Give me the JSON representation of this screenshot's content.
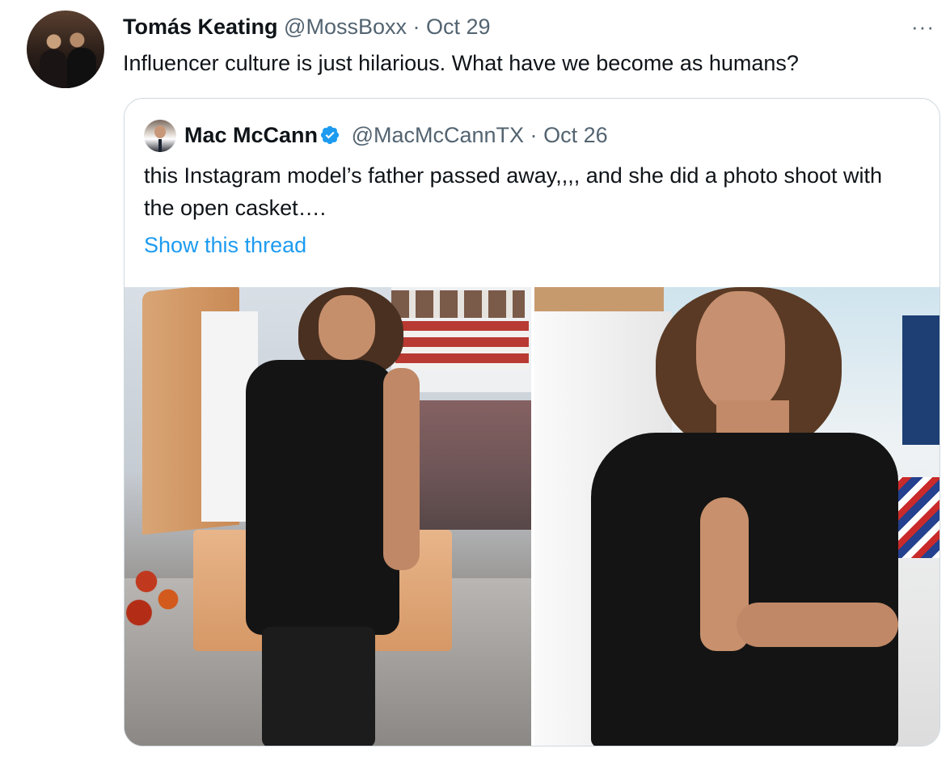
{
  "tweet": {
    "author_name": "Tomás Keating",
    "handle": "@MossBoxx",
    "separator": "·",
    "date": "Oct 29",
    "more_label": "···",
    "text": "Influencer culture is just hilarious. What have we become as humans?"
  },
  "quoted_tweet": {
    "author_name": "Mac McCann",
    "handle": "@MacMcCannTX",
    "separator": "·",
    "date": "Oct 26",
    "text": "this Instagram model’s father passed away,,,, and she did a photo shoot with the open casket….",
    "show_thread": "Show this thread",
    "verified": true
  },
  "colors": {
    "text": "#0f1419",
    "muted": "#536471",
    "link": "#1d9bf0",
    "verified": "#1d9bf0",
    "border": "#cfd9de"
  },
  "icons": {
    "verified": "verified-badge-icon",
    "more": "more-options-icon"
  }
}
